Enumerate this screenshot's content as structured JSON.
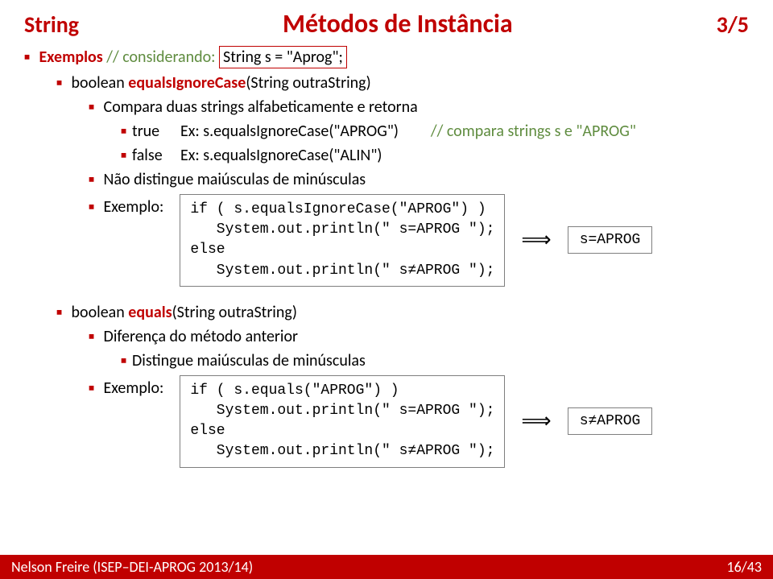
{
  "header": {
    "left": "String",
    "center": "Métodos de Instância",
    "right": "3/5"
  },
  "intro": {
    "bullet": "▪",
    "exemplos": "Exemplos",
    "comment1": "// considerando:",
    "decl": "String s = \"Aprog\";"
  },
  "sec1": {
    "sig_pre": "boolean ",
    "sig_method": "equalsIgnoreCase",
    "sig_post": "(String outraString)",
    "desc": "Compara duas strings alfabeticamente e retorna",
    "true_label": "true",
    "true_ex": "Ex:  s.equalsIgnoreCase(\"APROG\")",
    "true_comment": "// compara strings s e \"APROG\"",
    "false_label": "false",
    "false_ex": "Ex:  s.equalsIgnoreCase(\"ALIN\")",
    "note": "Não distingue maiúsculas de minúsculas",
    "exemplo_label": "Exemplo:",
    "code": "if ( s.equalsIgnoreCase(\"APROG\") )\n   System.out.println(\" s=APROG \");\nelse\n   System.out.println(\" s≠APROG \");",
    "arrow": "⟹",
    "result": "s=APROG"
  },
  "sec2": {
    "sig_pre": "boolean ",
    "sig_method": "equals",
    "sig_post": "(String  outraString)",
    "diff": "Diferença do método anterior",
    "note": "Distingue maiúsculas de minúsculas",
    "exemplo_label": "Exemplo:",
    "code": "if ( s.equals(\"APROG\") )\n   System.out.println(\" s=APROG \");\nelse\n   System.out.println(\" s≠APROG \");",
    "arrow": "⟹",
    "result": "s≠APROG"
  },
  "footer": {
    "left": "Nelson Freire (ISEP–DEI-APROG 2013/14)",
    "right": "16/43"
  }
}
